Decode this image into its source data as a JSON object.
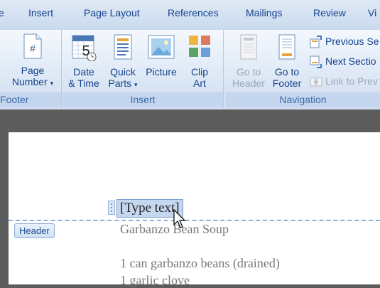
{
  "tabs": [
    "Insert",
    "Page Layout",
    "References",
    "Mailings",
    "Review",
    "Vi"
  ],
  "groups": {
    "footer_label": "Footer",
    "insert_label": "Insert",
    "navigation_label": "Navigation"
  },
  "buttons": {
    "page_number": [
      "Page",
      "Number"
    ],
    "date_time": [
      "Date",
      "& Time"
    ],
    "quick_parts": [
      "Quick",
      "Parts"
    ],
    "picture": [
      "Picture",
      ""
    ],
    "clip_art": [
      "Clip",
      "Art"
    ],
    "go_to_header": [
      "Go to",
      "Header"
    ],
    "go_to_footer": [
      "Go to",
      "Footer"
    ]
  },
  "nav": {
    "previous_section": "Previous Se",
    "next_section": "Next Sectio",
    "link_to_previous": "Link to Prev"
  },
  "document": {
    "placeholder": "[Type text]",
    "header_tag": "Header",
    "title": "Garbanzo Bean Soup",
    "line1": "1 can garbanzo beans (drained)",
    "line2": "1 garlic clove"
  },
  "colors": {
    "ribbon_text": "#15428b",
    "group_label": "#3e6aaa",
    "header_dash": "#8ab0dc"
  }
}
